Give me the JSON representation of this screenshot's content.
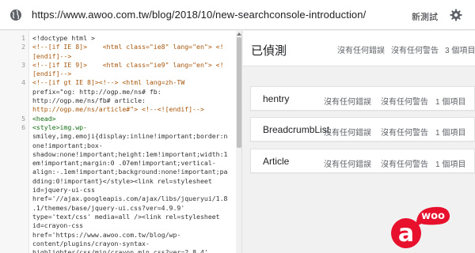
{
  "header": {
    "url": "https://www.awoo.com.tw/blog/2018/10/new-searchconsole-introduction/",
    "new_test_label": "新測試",
    "globe_icon": "globe-icon",
    "settings_icon": "gear-icon"
  },
  "code": {
    "lines": [
      {
        "n": "1",
        "t": "<!doctype html >"
      },
      {
        "n": "2",
        "t": "<!--[if IE 8]>    <html class=\"ie8\" lang=\"en\"> <!"
      },
      {
        "n": "",
        "t": "[endif]-->"
      },
      {
        "n": "3",
        "t": "<!--[if IE 9]>    <html class=\"ie9\" lang=\"en\"> <!"
      },
      {
        "n": "",
        "t": "[endif]-->"
      },
      {
        "n": "4",
        "t": "<!--[if gt IE 8]><!--> <html lang=zh-TW"
      },
      {
        "n": "",
        "t": "prefix=\"og: http://ogp.me/ns# fb:"
      },
      {
        "n": "",
        "t": "http://ogp.me/ns/fb# article:"
      },
      {
        "n": "",
        "t": "http://ogp.me/ns/article#\"> <!--<![endif]-->"
      },
      {
        "n": "5",
        "t": "<head>"
      },
      {
        "n": "6",
        "t": "<style>img.wp-"
      },
      {
        "n": "",
        "t": "smiley,img.emoji{display:inline!important;border:n"
      },
      {
        "n": "",
        "t": "one!important;box-"
      },
      {
        "n": "",
        "t": "shadow:none!important;height:1em!important;width:1"
      },
      {
        "n": "",
        "t": "em!important;margin:0 .07em!important;vertical-"
      },
      {
        "n": "",
        "t": "align:-.1em!important;background:none!important;pa"
      },
      {
        "n": "",
        "t": "dding:0!important}</style><link rel=stylesheet"
      },
      {
        "n": "",
        "t": "id=jquery-ui-css"
      },
      {
        "n": "",
        "t": "href='//ajax.googleapis.com/ajax/libs/jqueryui/1.8"
      },
      {
        "n": "",
        "t": ".1/themes/base/jquery-ui.css?ver=4.9.9'"
      },
      {
        "n": "",
        "t": "type='text/css' media=all /><link rel=stylesheet"
      },
      {
        "n": "",
        "t": "id=crayon-css"
      },
      {
        "n": "",
        "t": "href='https://www.awoo.com.tw/blog/wp-"
      },
      {
        "n": "",
        "t": "content/plugins/crayon-syntax-"
      },
      {
        "n": "",
        "t": "highlighter/css/min/crayon.min.css?ver=2.8.4'"
      }
    ]
  },
  "detected": {
    "title": "已偵測",
    "errors": "沒有任何錯誤",
    "warnings": "沒有任何警告",
    "items": "3 個項目"
  },
  "cards": [
    {
      "name": "hentry",
      "errors": "沒有任何錯誤",
      "warnings": "沒有任何警告",
      "items": "1 個項目"
    },
    {
      "name": "BreadcrumbList",
      "errors": "沒有任何錯誤",
      "warnings": "沒有任何警告",
      "items": "1 個項目"
    },
    {
      "name": "Article",
      "errors": "沒有任何錯誤",
      "warnings": "沒有任何警告",
      "items": "1 個項目"
    }
  ],
  "logo": {
    "text": "woo",
    "glyph": "a",
    "colors": {
      "red": "#e8112d",
      "white": "#ffffff"
    }
  }
}
